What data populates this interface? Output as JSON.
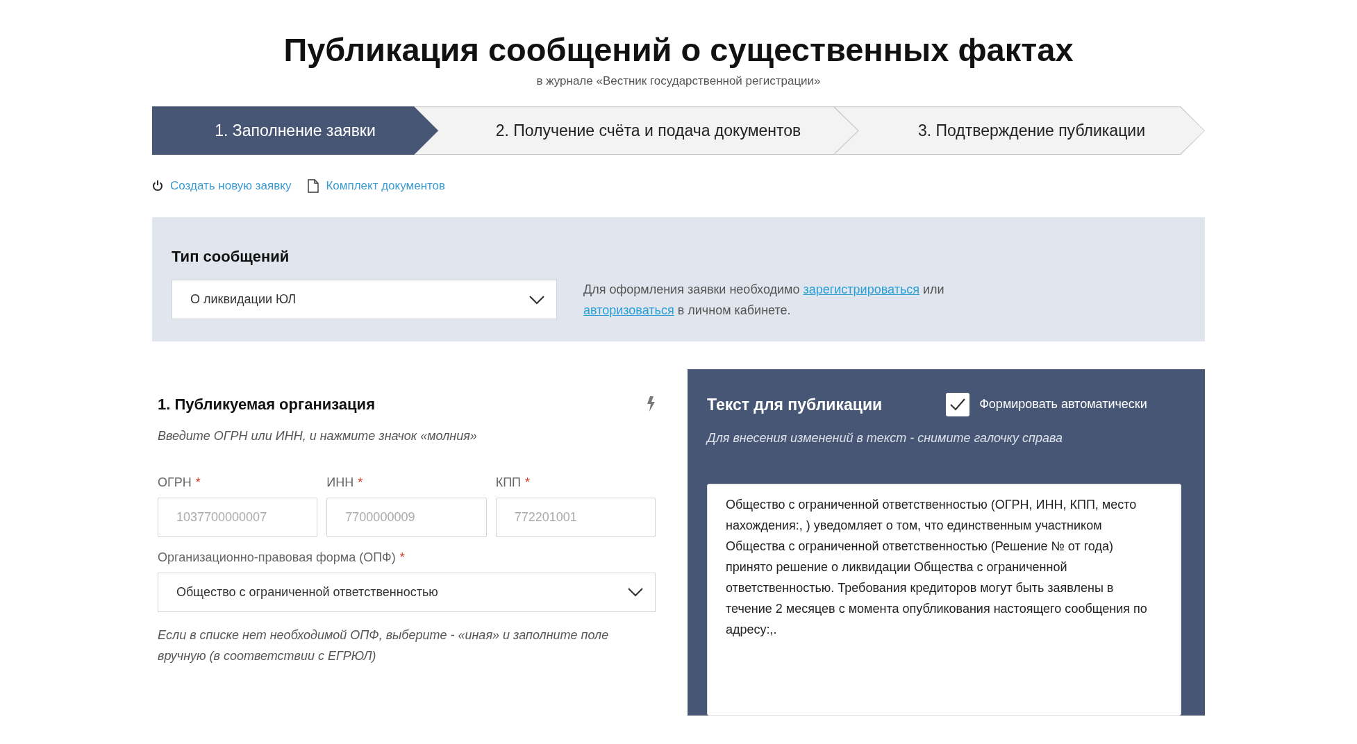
{
  "page": {
    "title": "Публикация сообщений о существенных фактах",
    "subtitle": "в журнале «Вестник государственной регистрации»"
  },
  "steps": [
    {
      "label": "1. Заполнение заявки",
      "selected": true
    },
    {
      "label": "2. Получение счёта и подача документов",
      "selected": false
    },
    {
      "label": "3. Подтверждение публикации",
      "selected": false
    }
  ],
  "actions": [
    {
      "kind": "new",
      "label": "Создать новую заявку"
    },
    {
      "kind": "docs",
      "label": "Комплект документов"
    }
  ],
  "message_type": {
    "label": "Тип сообщений",
    "value": "О ликвидации ЮЛ",
    "info": [
      {
        "kind": "text",
        "text": "Для оформления заявки необходимо "
      },
      {
        "kind": "link",
        "text": "зарегистрироваться"
      },
      {
        "kind": "text",
        "text": " или "
      },
      {
        "kind": "link",
        "text": "авторизоваться"
      },
      {
        "kind": "text",
        "text": " в личном кабинете."
      }
    ]
  },
  "organization": {
    "title": "1. Публикуемая организация",
    "hint": "Введите ОГРН или ИНН, и нажмите значок «молния»",
    "fields": [
      {
        "label": "ОГРН",
        "required_mark": "*",
        "placeholder": "1037700000007"
      },
      {
        "label": "ИНН",
        "required_mark": "*",
        "placeholder": "7700000009"
      },
      {
        "label": "КПП",
        "required_mark": "*",
        "placeholder": "772201001"
      }
    ],
    "opf": {
      "label": "Организационно-правовая форма (ОПФ)",
      "required_mark": "*",
      "value": "Общество с ограниченной ответственностью"
    },
    "note": "Если в списке нет необходимой ОПФ, выберите - «иная» и заполните поле вручную (в соответствии с ЕГРЮЛ)"
  },
  "publication": {
    "title": "Текст для публикации",
    "auto": {
      "label": "Формировать автоматически",
      "checked": true
    },
    "hint": "Для внесения изменений в текст - снимите галочку справа",
    "text": "Общество с ограниченной ответственностью (ОГРН, ИНН, КПП, место нахождения:, ) уведомляет о том, что единственным участником Общества с ограниченной ответственностью (Решение № от года) принято решение о ликвидации Общества с ограниченной ответственностью. Требования кредиторов могут быть заявлены в течение 2 месяцев с момента опубликования настоящего сообщения по адресу:,."
  }
}
